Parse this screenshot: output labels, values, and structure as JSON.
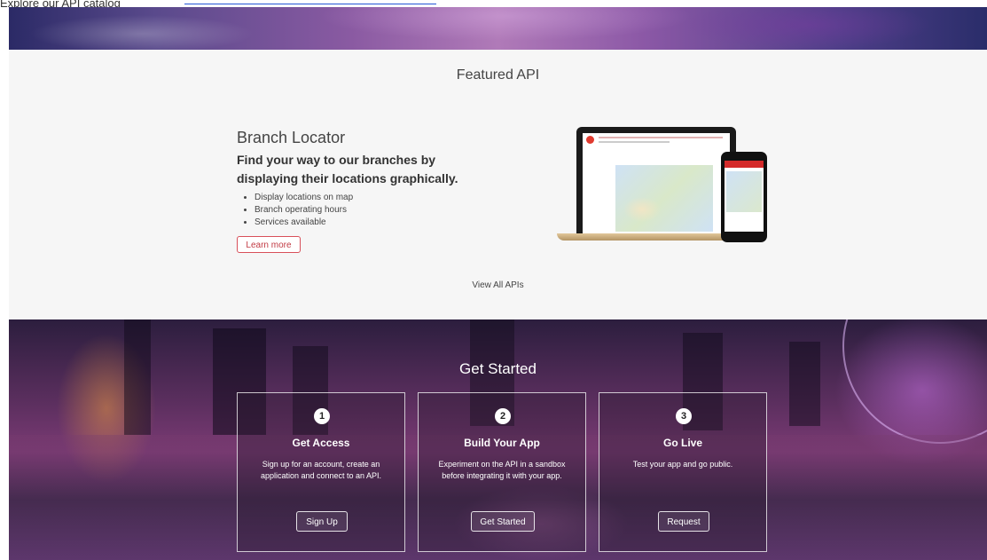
{
  "top_bar": {
    "text": "Explore our API catalog",
    "link": "https://developer.example.com/apis"
  },
  "featured": {
    "section_title": "Featured API",
    "api_name": "Branch Locator",
    "tagline": "Find your way to our branches by displaying their locations graphically.",
    "bullets": [
      "Display locations on map",
      "Branch operating hours",
      "Services available"
    ],
    "learn_more_label": "Learn more",
    "view_all_label": "View All APIs"
  },
  "get_started": {
    "title": "Get Started",
    "steps": [
      {
        "number": "1",
        "title": "Get Access",
        "description": "Sign up for an account, create an application and connect to an API.",
        "button": "Sign Up"
      },
      {
        "number": "2",
        "title": "Build Your App",
        "description": "Experiment on the API in a sandbox before integrating it with your app.",
        "button": "Get Started"
      },
      {
        "number": "3",
        "title": "Go Live",
        "description": "Test your app and go public.",
        "button": "Request"
      }
    ]
  },
  "colors": {
    "accent_red": "#d8505a",
    "link_blue": "#2456d6"
  }
}
